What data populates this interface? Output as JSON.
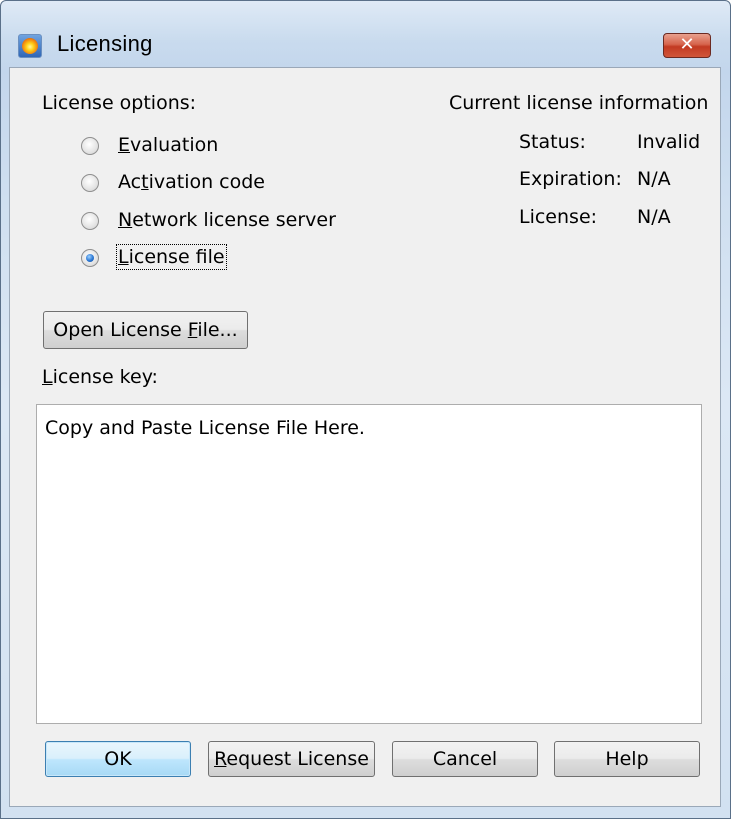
{
  "window": {
    "title": "Licensing",
    "close_symbol": "✕",
    "icon": "app-logo-icon"
  },
  "license_options": {
    "heading": "License options:",
    "options": [
      {
        "pre": "",
        "ul": "E",
        "post": "valuation",
        "checked": false
      },
      {
        "pre": "Ac",
        "ul": "t",
        "post": "ivation code",
        "checked": false
      },
      {
        "pre": "",
        "ul": "N",
        "post": "etwork license server",
        "checked": false
      },
      {
        "pre": "",
        "ul": "L",
        "post": "icense file",
        "checked": true
      }
    ]
  },
  "current_info": {
    "heading": "Current license information",
    "rows": [
      {
        "label": "Status:",
        "value": "Invalid"
      },
      {
        "label": "Expiration:",
        "value": "N/A"
      },
      {
        "label": "License:",
        "value": "N/A"
      }
    ]
  },
  "open_button": {
    "pre": "Open License ",
    "ul": "F",
    "post": "ile..."
  },
  "license_key": {
    "label_ul": "L",
    "label_post": "icense key:",
    "value": "Copy and Paste License File Here."
  },
  "buttons": {
    "ok": "OK",
    "request": {
      "ul": "R",
      "post": "equest License"
    },
    "cancel": "Cancel",
    "help": "Help"
  }
}
